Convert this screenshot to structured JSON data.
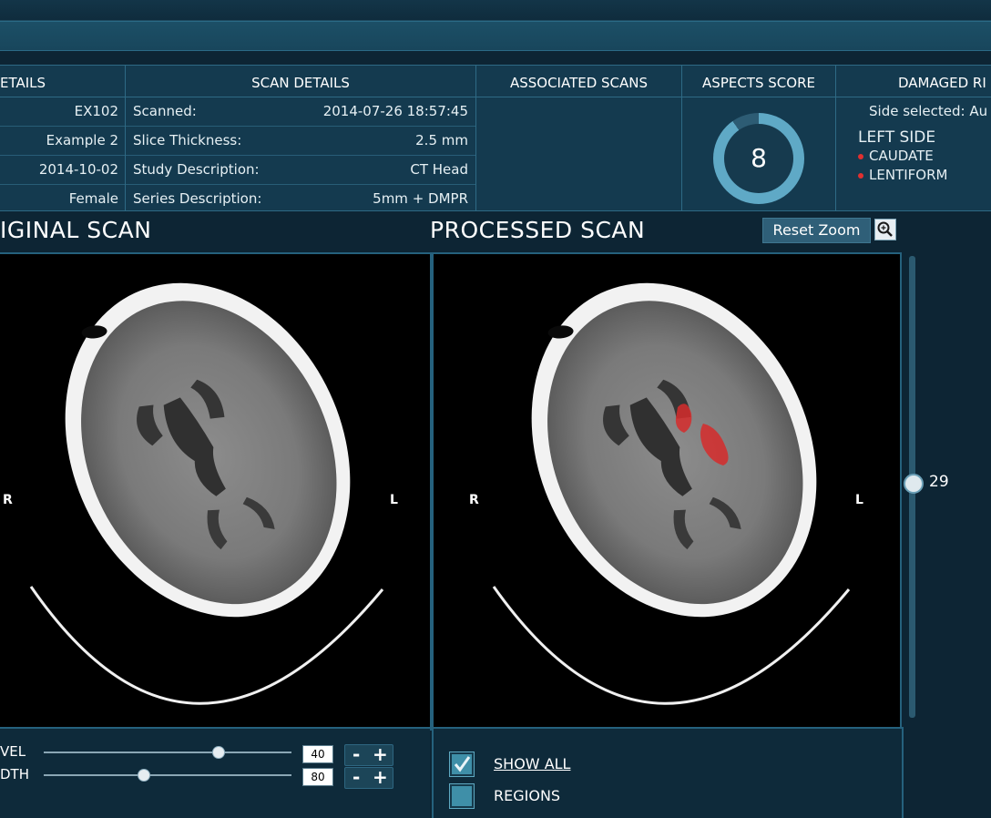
{
  "patient_details": {
    "header": "ETAILS",
    "rows": [
      "EX102",
      "Example 2",
      "2014-10-02",
      "Female"
    ]
  },
  "scan_details": {
    "header": "SCAN DETAILS",
    "rows": [
      {
        "key": "Scanned:",
        "value": "2014-07-26 18:57:45"
      },
      {
        "key": "Slice Thickness:",
        "value": "2.5 mm"
      },
      {
        "key": "Study Description:",
        "value": "CT Head"
      },
      {
        "key": "Series Description:",
        "value": "5mm + DMPR"
      }
    ]
  },
  "associated_scans": {
    "header": "ASSOCIATED SCANS"
  },
  "aspects": {
    "header": "ASPECTS SCORE",
    "score": "8"
  },
  "damaged_regions": {
    "header": "DAMAGED RI",
    "side_selected": "Side selected: Au",
    "side_title": "LEFT SIDE",
    "items": [
      "CAUDATE",
      "LENTIFORM"
    ],
    "marker_color": "#e03030"
  },
  "original": {
    "title": "IGINAL SCAN",
    "left_marker": "R",
    "right_marker": "L"
  },
  "processed": {
    "title": "PROCESSED SCAN",
    "left_marker": "R",
    "right_marker": "L"
  },
  "reset_zoom_label": "Reset Zoom",
  "zoom_icon": "magnifier-icon",
  "slice": {
    "value": "29"
  },
  "window": {
    "level_label": "VEL",
    "level_value": "40",
    "width_label": "DTH",
    "width_value": "80"
  },
  "display_options": [
    {
      "label": "SHOW ALL",
      "checked": true
    },
    {
      "label": "REGIONS",
      "checked": false
    }
  ],
  "colors": {
    "lesion": "#d62b2b",
    "accent": "#5fa9c6"
  }
}
